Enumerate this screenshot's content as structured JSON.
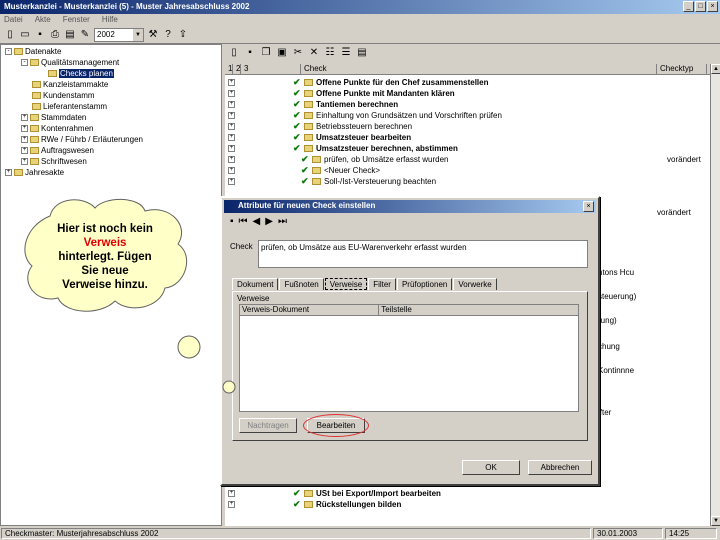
{
  "window": {
    "title": "Musterkanzlei - Musterkanzlei (5) - Muster Jahresabschluss 2002"
  },
  "menu": [
    "Datei",
    "Akte",
    "Fenster",
    "Hilfe"
  ],
  "toolbar": {
    "year": "2002"
  },
  "tree": [
    {
      "label": "Datenakte",
      "level": 0,
      "exp": "-"
    },
    {
      "label": "Qualitätsmanagement",
      "level": 1,
      "exp": "-"
    },
    {
      "label": "Checks planen",
      "level": 2,
      "exp": "",
      "selected": true
    },
    {
      "label": "Kanzleistammakte",
      "level": 1,
      "exp": ""
    },
    {
      "label": "Kundenstamm",
      "level": 1,
      "exp": ""
    },
    {
      "label": "Lieferantenstamm",
      "level": 1,
      "exp": ""
    },
    {
      "label": "Stammdaten",
      "level": 1,
      "exp": "+"
    },
    {
      "label": "Kontenrahmen",
      "level": 1,
      "exp": "+"
    },
    {
      "label": "RWe / Führb / Erläuterungen",
      "level": 1,
      "exp": "+"
    },
    {
      "label": "Auftragswesen",
      "level": 1,
      "exp": "+"
    },
    {
      "label": "Schriftwesen",
      "level": 1,
      "exp": "+"
    },
    {
      "label": "Jahresakte",
      "level": 0,
      "exp": "+"
    }
  ],
  "grid": {
    "headers": [
      "1",
      "2",
      "3",
      "Check",
      "Checktyp"
    ],
    "rows": [
      {
        "text": "Offene Punkte für den Chef zusammenstellen",
        "bold": true,
        "type": ""
      },
      {
        "text": "Offene Punkte mit Mandanten klären",
        "bold": true,
        "type": ""
      },
      {
        "text": "Tantiemen berechnen",
        "bold": true,
        "type": ""
      },
      {
        "text": "Einhaltung von Grundsätzen und Vorschriften prüfen",
        "bold": false,
        "type": ""
      },
      {
        "text": "Betriebssteuern berechnen",
        "bold": false,
        "type": ""
      },
      {
        "text": "Umsatzsteuer bearbeiten",
        "bold": true,
        "type": ""
      },
      {
        "text": "Umsatzsteuer berechnen, abstimmen",
        "bold": true,
        "type": ""
      },
      {
        "text": "prüfen, ob Umsätze erfasst wurden",
        "bold": false,
        "type": "vorändert"
      },
      {
        "text": "<Neuer Check>",
        "bold": false,
        "type": ""
      },
      {
        "text": "Soll-/Ist-Versteuerung beachten",
        "bold": false,
        "type": ""
      }
    ],
    "bottom_rows": [
      {
        "text": "USt bei Export/Import bearbeiten",
        "bold": true
      },
      {
        "text": "Rückstellungen bilden",
        "bold": true
      }
    ],
    "side_fragments": [
      "vorändert",
      "ntons Hcu",
      "steuerung)",
      "rung)",
      "chung",
      "Kontinnne",
      "ifter"
    ]
  },
  "dialog": {
    "title": "Attribute für neuen Check einstellen",
    "check_label": "Check",
    "check_value": "prüfen, ob Umsätze aus EU-Warenverkehr erfasst wurden",
    "tabs": [
      "Dokument",
      "Fußnoten",
      "Verweise",
      "Filter",
      "Prüfoptionen",
      "Vorwerke"
    ],
    "active_tab": "Verweise",
    "group_label": "Verweise",
    "col_doc": "Verweis-Dokument",
    "col_part": "Teilstelle",
    "btn_nachtragen": "Nachtragen",
    "btn_bearbeiten": "Bearbeiten",
    "btn_ok": "OK",
    "btn_abbrechen": "Abbrechen"
  },
  "bubble": {
    "line1": "Hier ist noch kein",
    "line2": "Verweis",
    "line3": "hinterlegt. Fügen",
    "line4": "Sie neue",
    "line5": "Verweise hinzu."
  },
  "status": {
    "left": "Checkmaster: Musterjahresabschluss 2002",
    "date": "30.01.2003",
    "time": "14:25"
  }
}
